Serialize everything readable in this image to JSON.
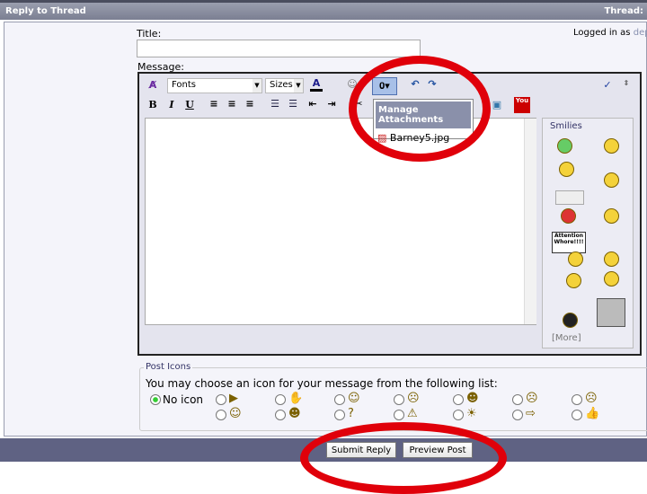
{
  "header": {
    "title": "Reply to Thread",
    "right": "Thread:"
  },
  "form": {
    "title_label": "Title:",
    "title_value": "",
    "logged_in": "Logged in as",
    "username": "dep",
    "message_label": "Message:"
  },
  "toolbar": {
    "font_select": "Fonts",
    "size_select": "Sizes",
    "bold": "B",
    "italic": "I",
    "underline": "U",
    "youtube": "You"
  },
  "attach_menu": {
    "header": "Manage Attachments",
    "items": [
      "Barney5.jpg"
    ]
  },
  "smilies": {
    "title": "Smilies",
    "more": "[More]",
    "attention_sign": "Attention Whore!!!!"
  },
  "post_icons": {
    "legend": "Post Icons",
    "instruction": "You may choose an icon for your message from the following list:",
    "no_icon": "No icon",
    "selected": "No icon"
  },
  "buttons": {
    "submit": "Submit Reply",
    "preview": "Preview Post"
  },
  "colors": {
    "annotation": "#e0000a",
    "header": "#8a8ea0",
    "bottom_bar": "#5f6283"
  }
}
